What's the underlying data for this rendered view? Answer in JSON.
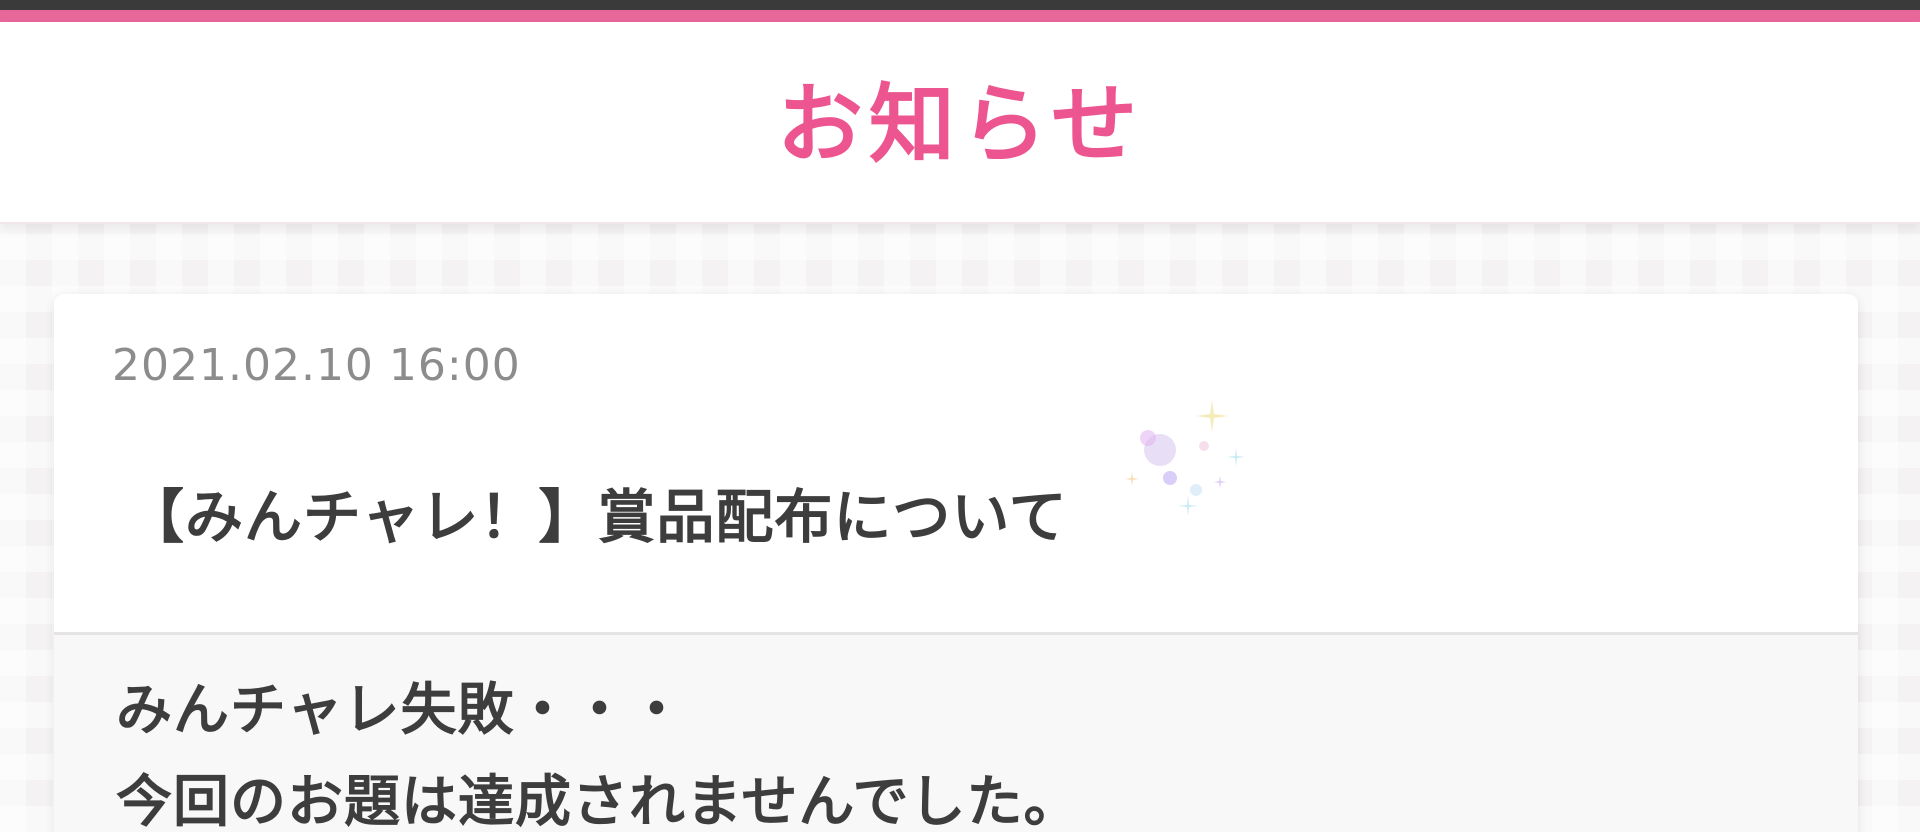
{
  "header": {
    "title": "お知らせ"
  },
  "notice": {
    "date": "2021.02.10 16:00",
    "title": "【みんチャレ！】賞品配布について",
    "body": [
      "みんチャレ失敗・・・",
      "今回のお題は達成されませんでした。"
    ]
  },
  "colors": {
    "accent": "#ed5590",
    "top_bar": "#3a3a3a",
    "text": "#3d3d3d",
    "date": "#8c8c8c"
  },
  "icons": {
    "decoration": "sparkle-icon"
  }
}
